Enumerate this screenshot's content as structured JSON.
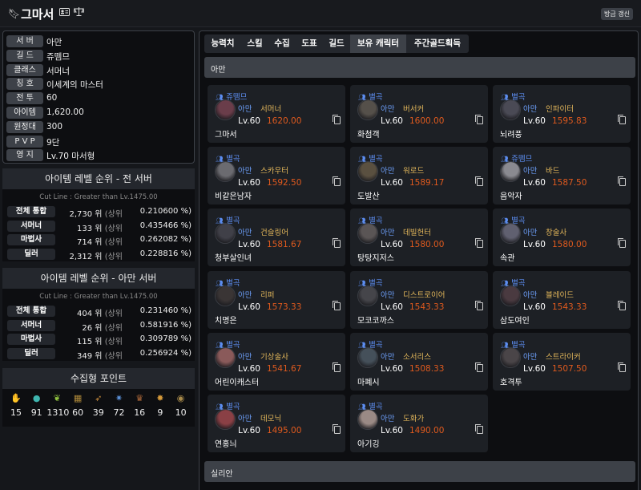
{
  "header": {
    "name": "그마서",
    "refresh_label": "방금 갱신"
  },
  "profile": [
    {
      "label": "서 버",
      "value": "아만"
    },
    {
      "label": "길 드",
      "value": "쥬뗌므"
    },
    {
      "label": "클래스",
      "value": "서머너"
    },
    {
      "label": "칭 호",
      "value": "이세계의 마스터"
    },
    {
      "label": "전 투",
      "value": "60"
    },
    {
      "label": "아이템",
      "value": "1,620.00"
    },
    {
      "label": "원정대",
      "value": "300"
    },
    {
      "label": "P V P",
      "value": "9단"
    },
    {
      "label": "영 지",
      "value": "Lv.70 마서형"
    }
  ],
  "ranking_all": {
    "title": "아이템 레벨 순위 - 전 서버",
    "cutline": "Cut Line : Greater than Lv.1475.00",
    "rows": [
      {
        "label": "전체 통합",
        "rank": "2,730 위",
        "upper": "(상위",
        "pct": "0.210600 %)"
      },
      {
        "label": "서머너",
        "rank": "133 위",
        "upper": "(상위",
        "pct": "0.435466 %)"
      },
      {
        "label": "마법사",
        "rank": "714 위",
        "upper": "(상위",
        "pct": "0.262082 %)"
      },
      {
        "label": "딜러",
        "rank": "2,312 위",
        "upper": "(상위",
        "pct": "0.228816 %)"
      }
    ]
  },
  "ranking_server": {
    "title": "아이템 레벨 순위 - 아만 서버",
    "cutline": "Cut Line : Greater than Lv.1475.00",
    "rows": [
      {
        "label": "전체 통합",
        "rank": "404 위",
        "upper": "(상위",
        "pct": "0.231460 %)"
      },
      {
        "label": "서머너",
        "rank": "26 위",
        "upper": "(상위",
        "pct": "0.581916 %)"
      },
      {
        "label": "마법사",
        "rank": "115 위",
        "upper": "(상위",
        "pct": "0.309789 %)"
      },
      {
        "label": "딜러",
        "rank": "349 위",
        "upper": "(상위",
        "pct": "0.256924 %)"
      }
    ]
  },
  "collection": {
    "title": "수집형 포인트",
    "items": [
      {
        "icon": "mokoko-seed-icon",
        "value": "15",
        "color": "#c9c0a8"
      },
      {
        "icon": "island-heart-icon",
        "value": "91",
        "color": "#3fb6b0"
      },
      {
        "icon": "giant-heart-icon",
        "value": "1310",
        "color": "#8fc23f"
      },
      {
        "icon": "great-artwork-icon",
        "value": "60",
        "color": "#b08a3a"
      },
      {
        "icon": "voyage-icon",
        "value": "39",
        "color": "#c68a3c"
      },
      {
        "icon": "ignea-token-icon",
        "value": "72",
        "color": "#5a8fd6"
      },
      {
        "icon": "world-tree-leaf-icon",
        "value": "16",
        "color": "#b06a3a"
      },
      {
        "icon": "orpheus-star-icon",
        "value": "9",
        "color": "#d69a3a"
      },
      {
        "icon": "sea-bounty-icon",
        "value": "10",
        "color": "#a88a4a"
      }
    ]
  },
  "tabs": [
    "능력치",
    "스킬",
    "수집",
    "도표",
    "길드",
    "보유 캐릭터",
    "주간골드획득"
  ],
  "active_tab": "보유 캐릭터",
  "server_sections": [
    "아만",
    "실리안"
  ],
  "characters": [
    {
      "guild": "쥬뗌므",
      "server": "아만",
      "class": "서머너",
      "level": "Lv.60",
      "ilvl": "1620.00",
      "name": "그마서",
      "color": "#6a3d4a"
    },
    {
      "guild": "별곡",
      "server": "아만",
      "class": "버서커",
      "level": "Lv.60",
      "ilvl": "1600.00",
      "name": "화첨객",
      "color": "#55504a"
    },
    {
      "guild": "별곡",
      "server": "아만",
      "class": "인파이터",
      "level": "Lv.60",
      "ilvl": "1595.83",
      "name": "뇌려풍",
      "color": "#4a4a55"
    },
    {
      "guild": "별곡",
      "server": "아만",
      "class": "스카우터",
      "level": "Lv.60",
      "ilvl": "1592.50",
      "name": "비같은남자",
      "color": "#6b6b70"
    },
    {
      "guild": "별곡",
      "server": "아만",
      "class": "워로드",
      "level": "Lv.60",
      "ilvl": "1589.17",
      "name": "도발산",
      "color": "#5a5040"
    },
    {
      "guild": "쥬뗌므",
      "server": "아만",
      "class": "바드",
      "level": "Lv.60",
      "ilvl": "1587.50",
      "name": "음악자",
      "color": "#8a8a90"
    },
    {
      "guild": "별곡",
      "server": "아만",
      "class": "건슬링어",
      "level": "Lv.60",
      "ilvl": "1581.67",
      "name": "청부살인녀",
      "color": "#404048"
    },
    {
      "guild": "별곡",
      "server": "아만",
      "class": "데빌헌터",
      "level": "Lv.60",
      "ilvl": "1580.00",
      "name": "탕탕지저스",
      "color": "#5a5555"
    },
    {
      "guild": "별곡",
      "server": "아만",
      "class": "창술사",
      "level": "Lv.60",
      "ilvl": "1580.00",
      "name": "속관",
      "color": "#606070"
    },
    {
      "guild": "별곡",
      "server": "아만",
      "class": "리퍼",
      "level": "Lv.60",
      "ilvl": "1573.33",
      "name": "치명은",
      "color": "#3a3535"
    },
    {
      "guild": "별곡",
      "server": "아만",
      "class": "디스트로이어",
      "level": "Lv.60",
      "ilvl": "1543.33",
      "name": "모코코까스",
      "color": "#45454a"
    },
    {
      "guild": "별곡",
      "server": "아만",
      "class": "블레이드",
      "level": "Lv.60",
      "ilvl": "1543.33",
      "name": "삼도여인",
      "color": "#4a3a40"
    },
    {
      "guild": "별곡",
      "server": "아만",
      "class": "기상술사",
      "level": "Lv.60",
      "ilvl": "1541.67",
      "name": "어린이캐스터",
      "color": "#8a5a5a"
    },
    {
      "guild": "별곡",
      "server": "아만",
      "class": "소서리스",
      "level": "Lv.60",
      "ilvl": "1508.33",
      "name": "마폐시",
      "color": "#45505a"
    },
    {
      "guild": "별곡",
      "server": "아만",
      "class": "스트라이커",
      "level": "Lv.60",
      "ilvl": "1507.50",
      "name": "호격투",
      "color": "#4a4548"
    },
    {
      "guild": "별곡",
      "server": "아만",
      "class": "데모닉",
      "level": "Lv.60",
      "ilvl": "1495.00",
      "name": "연홍늬",
      "color": "#8a4045"
    },
    {
      "guild": "별곡",
      "server": "아만",
      "class": "도화가",
      "level": "Lv.60",
      "ilvl": "1490.00",
      "name": "아기깅",
      "color": "#9a8a85"
    }
  ]
}
